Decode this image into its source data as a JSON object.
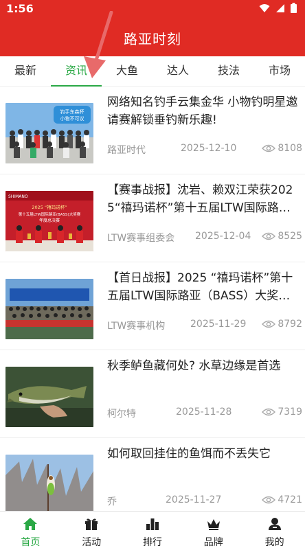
{
  "status_bar": {
    "time": "1:56"
  },
  "app_bar": {
    "title": "路亚时刻"
  },
  "tabs": [
    {
      "label": "最新"
    },
    {
      "label": "资讯"
    },
    {
      "label": "大鱼"
    },
    {
      "label": "达人"
    },
    {
      "label": "技法"
    },
    {
      "label": "市场"
    }
  ],
  "active_tab": "资讯",
  "accent_color": "#2aa845",
  "brand_color": "#e02b24",
  "articles": [
    {
      "title": "网络知名钓手云集金华 小物钓明星邀请赛解锁垂钓新乐趣!",
      "source": "路亚时代",
      "date": "2025-12-10",
      "views": "8108",
      "image_text": "钓手东森杯 小物不可议"
    },
    {
      "title": "【赛事战报】沈岩、赖双江荣获2025“禧玛诺杯”第十五届LTW国际路…",
      "source": "LTW赛事组委会",
      "date": "2025-12-04",
      "views": "8525",
      "image_text": "第十五届LTW国际路亚(BASS)大奖赛 年度总决赛"
    },
    {
      "title": "【首日战报】2025 “禧玛诺杯”第十五届LTW国际路亚（BASS）大奖…",
      "source": "LTW赛事机构",
      "date": "2025-11-29",
      "views": "8792",
      "image_text": ""
    },
    {
      "title": "秋季鲈鱼藏何处? 水草边缘是首选",
      "source": "柯尔特",
      "date": "2025-11-28",
      "views": "7319",
      "image_text": ""
    },
    {
      "title": "如何取回挂住的鱼饵而不丢失它",
      "source": "乔",
      "date": "2025-11-27",
      "views": "4721",
      "image_text": ""
    }
  ],
  "bottom_nav": [
    {
      "label": "首页",
      "icon": "home-icon"
    },
    {
      "label": "活动",
      "icon": "gift-icon"
    },
    {
      "label": "排行",
      "icon": "bar-chart-icon"
    },
    {
      "label": "品牌",
      "icon": "crown-icon"
    },
    {
      "label": "我的",
      "icon": "user-icon"
    }
  ],
  "active_nav": "首页"
}
